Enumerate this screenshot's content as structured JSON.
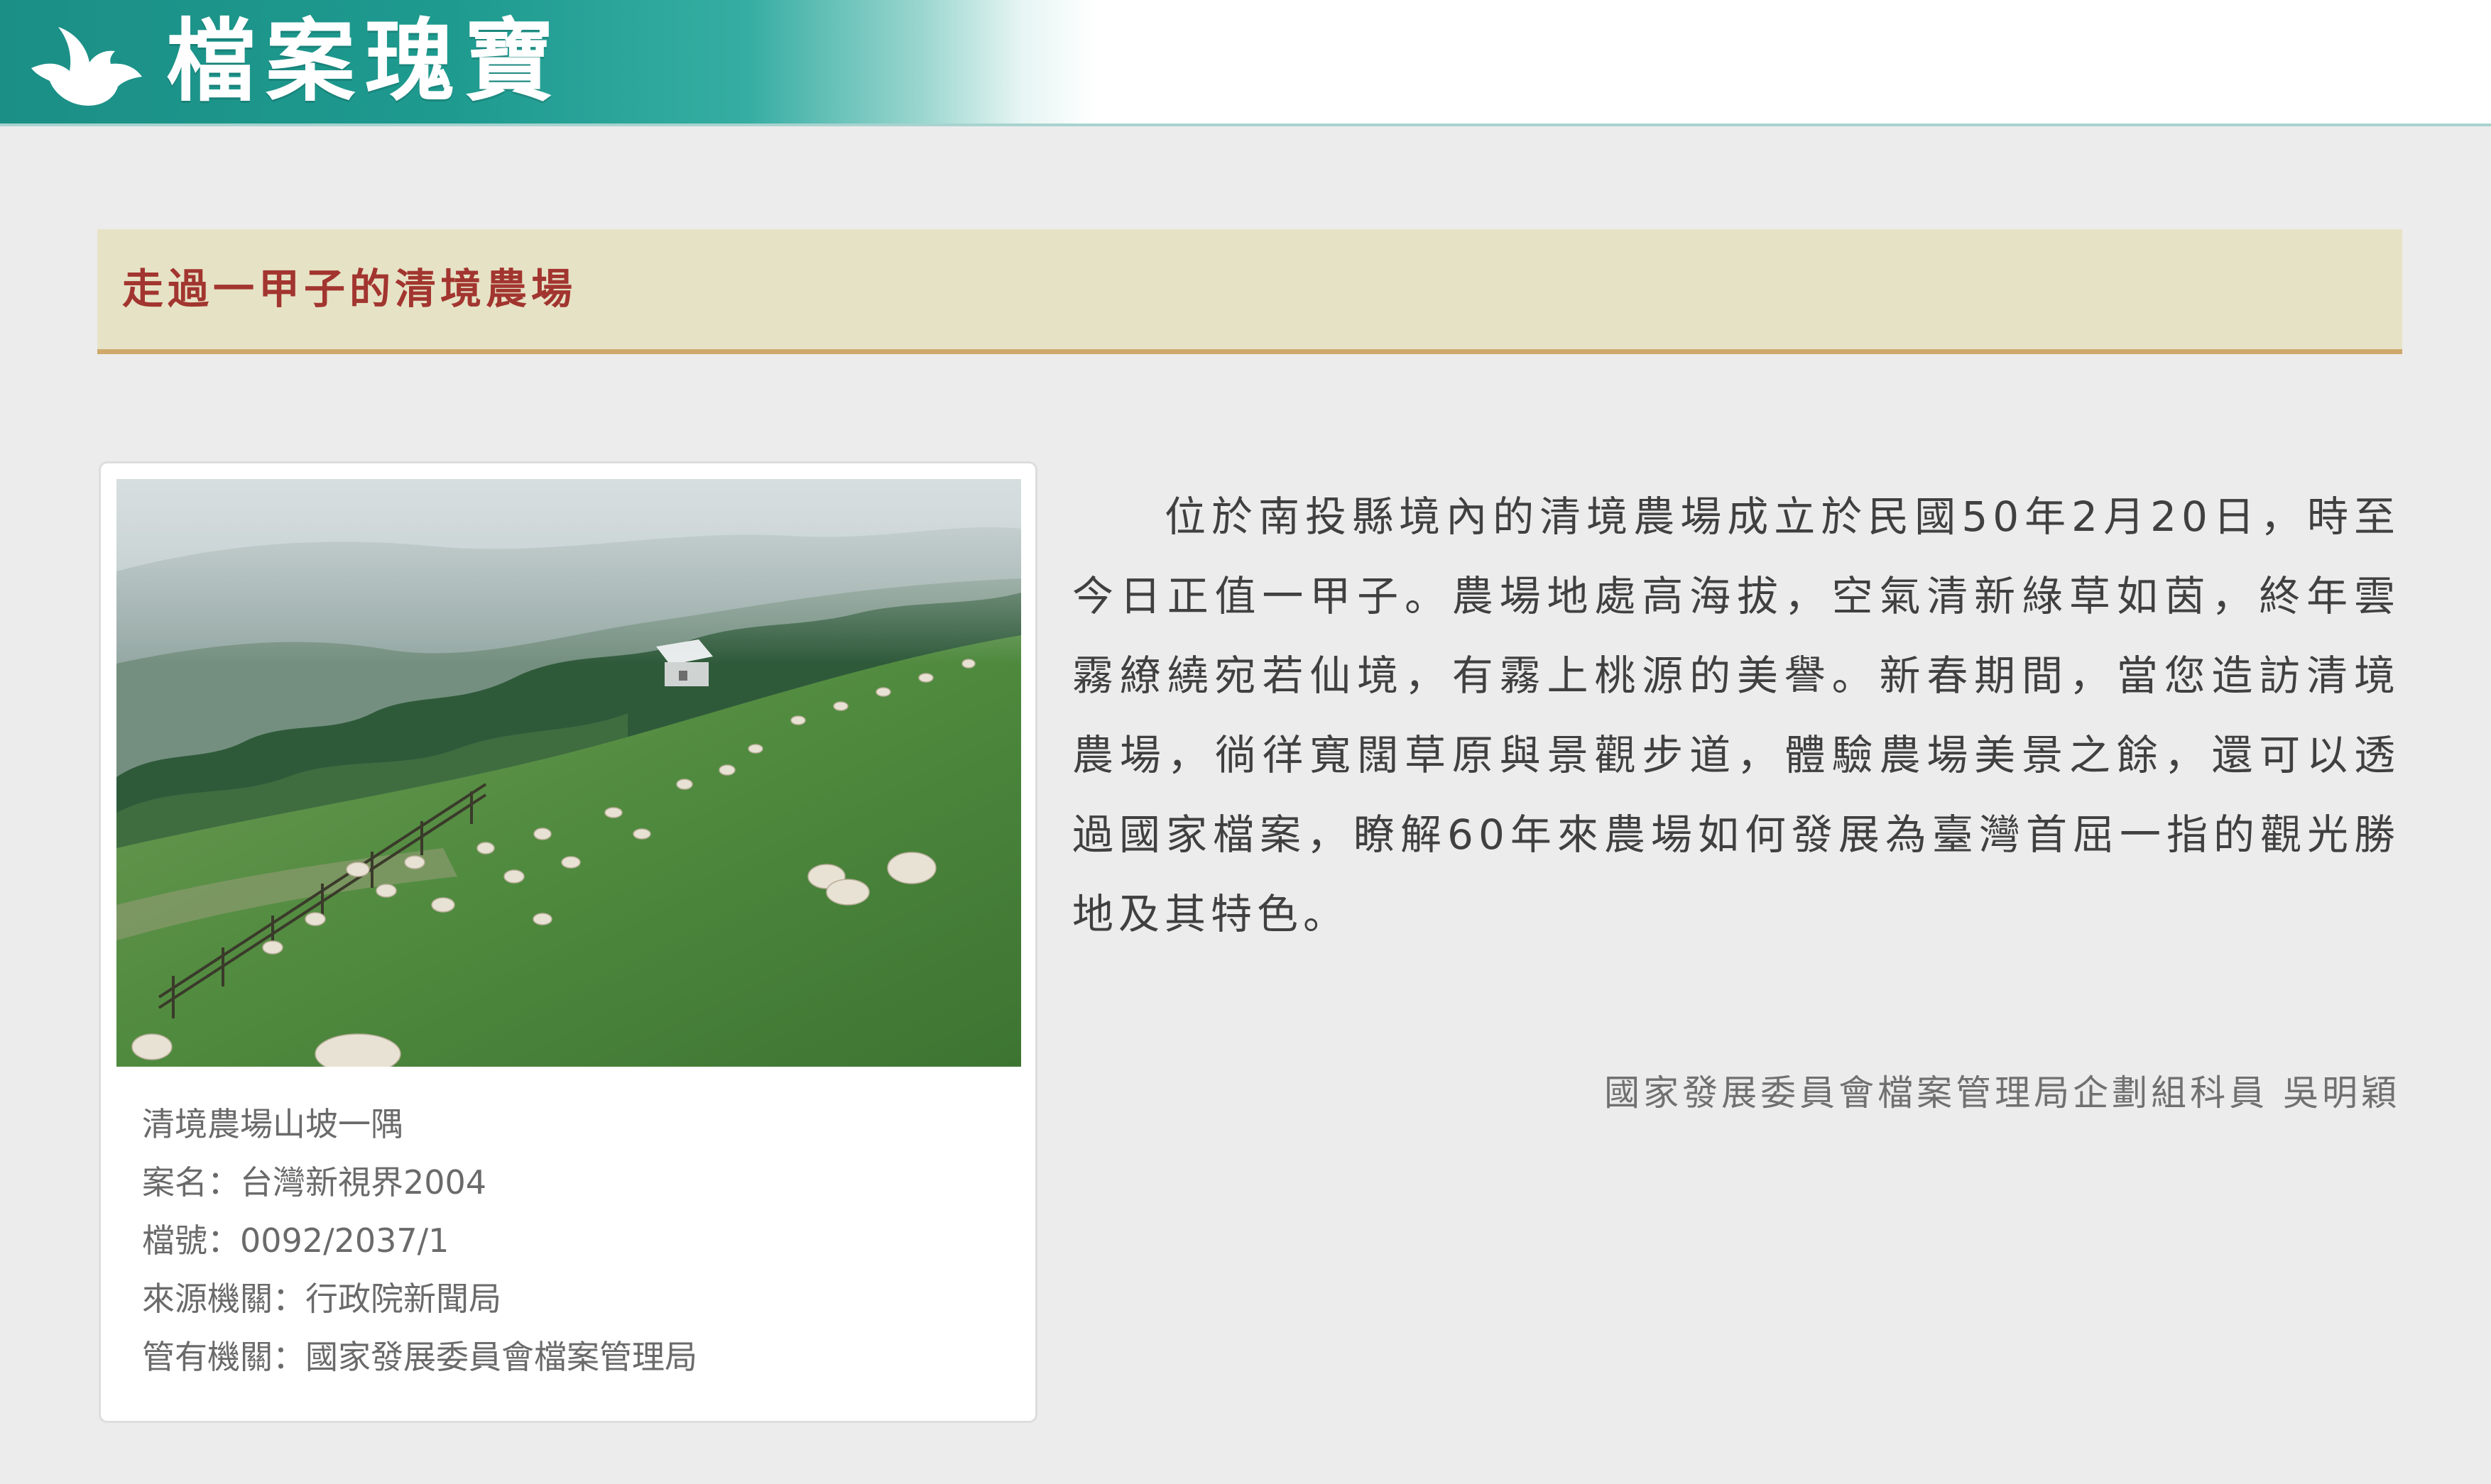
{
  "header": {
    "site_title": "檔案瑰寶",
    "logo_icon": "bird-logo-icon"
  },
  "article": {
    "title": "走過一甲子的清境農場",
    "body": "位於南投縣境內的清境農場成立於民國50年2月20日，時至今日正值一甲子。農場地處高海拔，空氣清新綠草如茵，終年雲霧繚繞宛若仙境，有霧上桃源的美譽。新春期間，當您造訪清境農場，徜徉寬闊草原與景觀步道，體驗農場美景之餘，還可以透過國家檔案，瞭解60年來農場如何發展為臺灣首屈一指的觀光勝地及其特色。",
    "author": "國家發展委員會檔案管理局企劃組科員 吳明穎"
  },
  "figure": {
    "caption": "清境農場山坡一隅",
    "case_name": "案名：台灣新視界2004",
    "file_no": "檔號：0092/2037/1",
    "source_agency": "來源機關：行政院新聞局",
    "custodian": "管有機關：國家發展委員會檔案管理局"
  },
  "colors": {
    "header_teal": "#1b8f86",
    "title_band_bg": "#e6e2c6",
    "title_band_border": "#cfa96b",
    "title_text": "#a2352f",
    "page_bg": "#ececec"
  }
}
